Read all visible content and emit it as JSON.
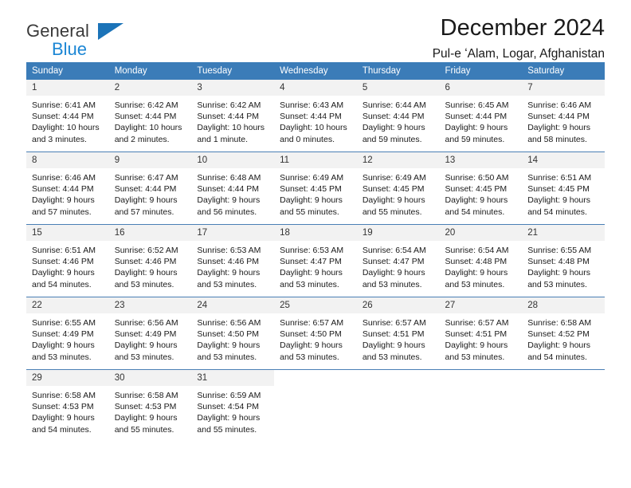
{
  "logo": {
    "primary_text": "General",
    "secondary_text": "Blue",
    "primary_color": "#3a3a3a",
    "secondary_color": "#1b86d4",
    "triangle_color": "#1b73b8"
  },
  "header": {
    "title": "December 2024",
    "subtitle": "Pul-e ʻAlam, Logar, Afghanistan"
  },
  "theme": {
    "header_bg": "#3b7cb8",
    "header_text": "#ffffff",
    "daynum_bg": "#f2f2f2",
    "row_divider": "#4a7fb5"
  },
  "weekdays": [
    "Sunday",
    "Monday",
    "Tuesday",
    "Wednesday",
    "Thursday",
    "Friday",
    "Saturday"
  ],
  "weeks": [
    [
      {
        "day": "1",
        "sunrise": "Sunrise: 6:41 AM",
        "sunset": "Sunset: 4:44 PM",
        "daylight": "Daylight: 10 hours and 3 minutes."
      },
      {
        "day": "2",
        "sunrise": "Sunrise: 6:42 AM",
        "sunset": "Sunset: 4:44 PM",
        "daylight": "Daylight: 10 hours and 2 minutes."
      },
      {
        "day": "3",
        "sunrise": "Sunrise: 6:42 AM",
        "sunset": "Sunset: 4:44 PM",
        "daylight": "Daylight: 10 hours and 1 minute."
      },
      {
        "day": "4",
        "sunrise": "Sunrise: 6:43 AM",
        "sunset": "Sunset: 4:44 PM",
        "daylight": "Daylight: 10 hours and 0 minutes."
      },
      {
        "day": "5",
        "sunrise": "Sunrise: 6:44 AM",
        "sunset": "Sunset: 4:44 PM",
        "daylight": "Daylight: 9 hours and 59 minutes."
      },
      {
        "day": "6",
        "sunrise": "Sunrise: 6:45 AM",
        "sunset": "Sunset: 4:44 PM",
        "daylight": "Daylight: 9 hours and 59 minutes."
      },
      {
        "day": "7",
        "sunrise": "Sunrise: 6:46 AM",
        "sunset": "Sunset: 4:44 PM",
        "daylight": "Daylight: 9 hours and 58 minutes."
      }
    ],
    [
      {
        "day": "8",
        "sunrise": "Sunrise: 6:46 AM",
        "sunset": "Sunset: 4:44 PM",
        "daylight": "Daylight: 9 hours and 57 minutes."
      },
      {
        "day": "9",
        "sunrise": "Sunrise: 6:47 AM",
        "sunset": "Sunset: 4:44 PM",
        "daylight": "Daylight: 9 hours and 57 minutes."
      },
      {
        "day": "10",
        "sunrise": "Sunrise: 6:48 AM",
        "sunset": "Sunset: 4:44 PM",
        "daylight": "Daylight: 9 hours and 56 minutes."
      },
      {
        "day": "11",
        "sunrise": "Sunrise: 6:49 AM",
        "sunset": "Sunset: 4:45 PM",
        "daylight": "Daylight: 9 hours and 55 minutes."
      },
      {
        "day": "12",
        "sunrise": "Sunrise: 6:49 AM",
        "sunset": "Sunset: 4:45 PM",
        "daylight": "Daylight: 9 hours and 55 minutes."
      },
      {
        "day": "13",
        "sunrise": "Sunrise: 6:50 AM",
        "sunset": "Sunset: 4:45 PM",
        "daylight": "Daylight: 9 hours and 54 minutes."
      },
      {
        "day": "14",
        "sunrise": "Sunrise: 6:51 AM",
        "sunset": "Sunset: 4:45 PM",
        "daylight": "Daylight: 9 hours and 54 minutes."
      }
    ],
    [
      {
        "day": "15",
        "sunrise": "Sunrise: 6:51 AM",
        "sunset": "Sunset: 4:46 PM",
        "daylight": "Daylight: 9 hours and 54 minutes."
      },
      {
        "day": "16",
        "sunrise": "Sunrise: 6:52 AM",
        "sunset": "Sunset: 4:46 PM",
        "daylight": "Daylight: 9 hours and 53 minutes."
      },
      {
        "day": "17",
        "sunrise": "Sunrise: 6:53 AM",
        "sunset": "Sunset: 4:46 PM",
        "daylight": "Daylight: 9 hours and 53 minutes."
      },
      {
        "day": "18",
        "sunrise": "Sunrise: 6:53 AM",
        "sunset": "Sunset: 4:47 PM",
        "daylight": "Daylight: 9 hours and 53 minutes."
      },
      {
        "day": "19",
        "sunrise": "Sunrise: 6:54 AM",
        "sunset": "Sunset: 4:47 PM",
        "daylight": "Daylight: 9 hours and 53 minutes."
      },
      {
        "day": "20",
        "sunrise": "Sunrise: 6:54 AM",
        "sunset": "Sunset: 4:48 PM",
        "daylight": "Daylight: 9 hours and 53 minutes."
      },
      {
        "day": "21",
        "sunrise": "Sunrise: 6:55 AM",
        "sunset": "Sunset: 4:48 PM",
        "daylight": "Daylight: 9 hours and 53 minutes."
      }
    ],
    [
      {
        "day": "22",
        "sunrise": "Sunrise: 6:55 AM",
        "sunset": "Sunset: 4:49 PM",
        "daylight": "Daylight: 9 hours and 53 minutes."
      },
      {
        "day": "23",
        "sunrise": "Sunrise: 6:56 AM",
        "sunset": "Sunset: 4:49 PM",
        "daylight": "Daylight: 9 hours and 53 minutes."
      },
      {
        "day": "24",
        "sunrise": "Sunrise: 6:56 AM",
        "sunset": "Sunset: 4:50 PM",
        "daylight": "Daylight: 9 hours and 53 minutes."
      },
      {
        "day": "25",
        "sunrise": "Sunrise: 6:57 AM",
        "sunset": "Sunset: 4:50 PM",
        "daylight": "Daylight: 9 hours and 53 minutes."
      },
      {
        "day": "26",
        "sunrise": "Sunrise: 6:57 AM",
        "sunset": "Sunset: 4:51 PM",
        "daylight": "Daylight: 9 hours and 53 minutes."
      },
      {
        "day": "27",
        "sunrise": "Sunrise: 6:57 AM",
        "sunset": "Sunset: 4:51 PM",
        "daylight": "Daylight: 9 hours and 53 minutes."
      },
      {
        "day": "28",
        "sunrise": "Sunrise: 6:58 AM",
        "sunset": "Sunset: 4:52 PM",
        "daylight": "Daylight: 9 hours and 54 minutes."
      }
    ],
    [
      {
        "day": "29",
        "sunrise": "Sunrise: 6:58 AM",
        "sunset": "Sunset: 4:53 PM",
        "daylight": "Daylight: 9 hours and 54 minutes."
      },
      {
        "day": "30",
        "sunrise": "Sunrise: 6:58 AM",
        "sunset": "Sunset: 4:53 PM",
        "daylight": "Daylight: 9 hours and 55 minutes."
      },
      {
        "day": "31",
        "sunrise": "Sunrise: 6:59 AM",
        "sunset": "Sunset: 4:54 PM",
        "daylight": "Daylight: 9 hours and 55 minutes."
      },
      {
        "day": "",
        "sunrise": "",
        "sunset": "",
        "daylight": ""
      },
      {
        "day": "",
        "sunrise": "",
        "sunset": "",
        "daylight": ""
      },
      {
        "day": "",
        "sunrise": "",
        "sunset": "",
        "daylight": ""
      },
      {
        "day": "",
        "sunrise": "",
        "sunset": "",
        "daylight": ""
      }
    ]
  ]
}
